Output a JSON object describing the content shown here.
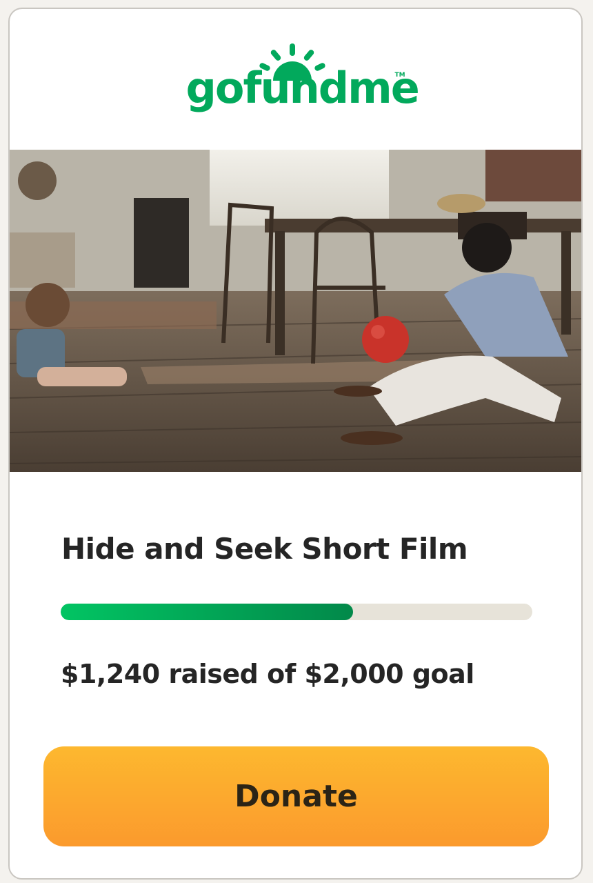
{
  "brand": {
    "logo_text": "gofundme",
    "trademark": "TM",
    "color": "#02a95c"
  },
  "campaign": {
    "image_icon": "campaign-photo",
    "title": "Hide and Seek Short Film",
    "amount_text": "$1,240 raised of $2,000 goal",
    "raised": 1240,
    "goal": 2000,
    "progress_fraction": 0.62
  },
  "actions": {
    "donate_label": "Donate",
    "donate_color": "#fcab2e"
  },
  "colors": {
    "progress_start": "#02c463",
    "progress_end": "#02894a",
    "progress_track": "#e7e3d9",
    "text": "#252525"
  }
}
